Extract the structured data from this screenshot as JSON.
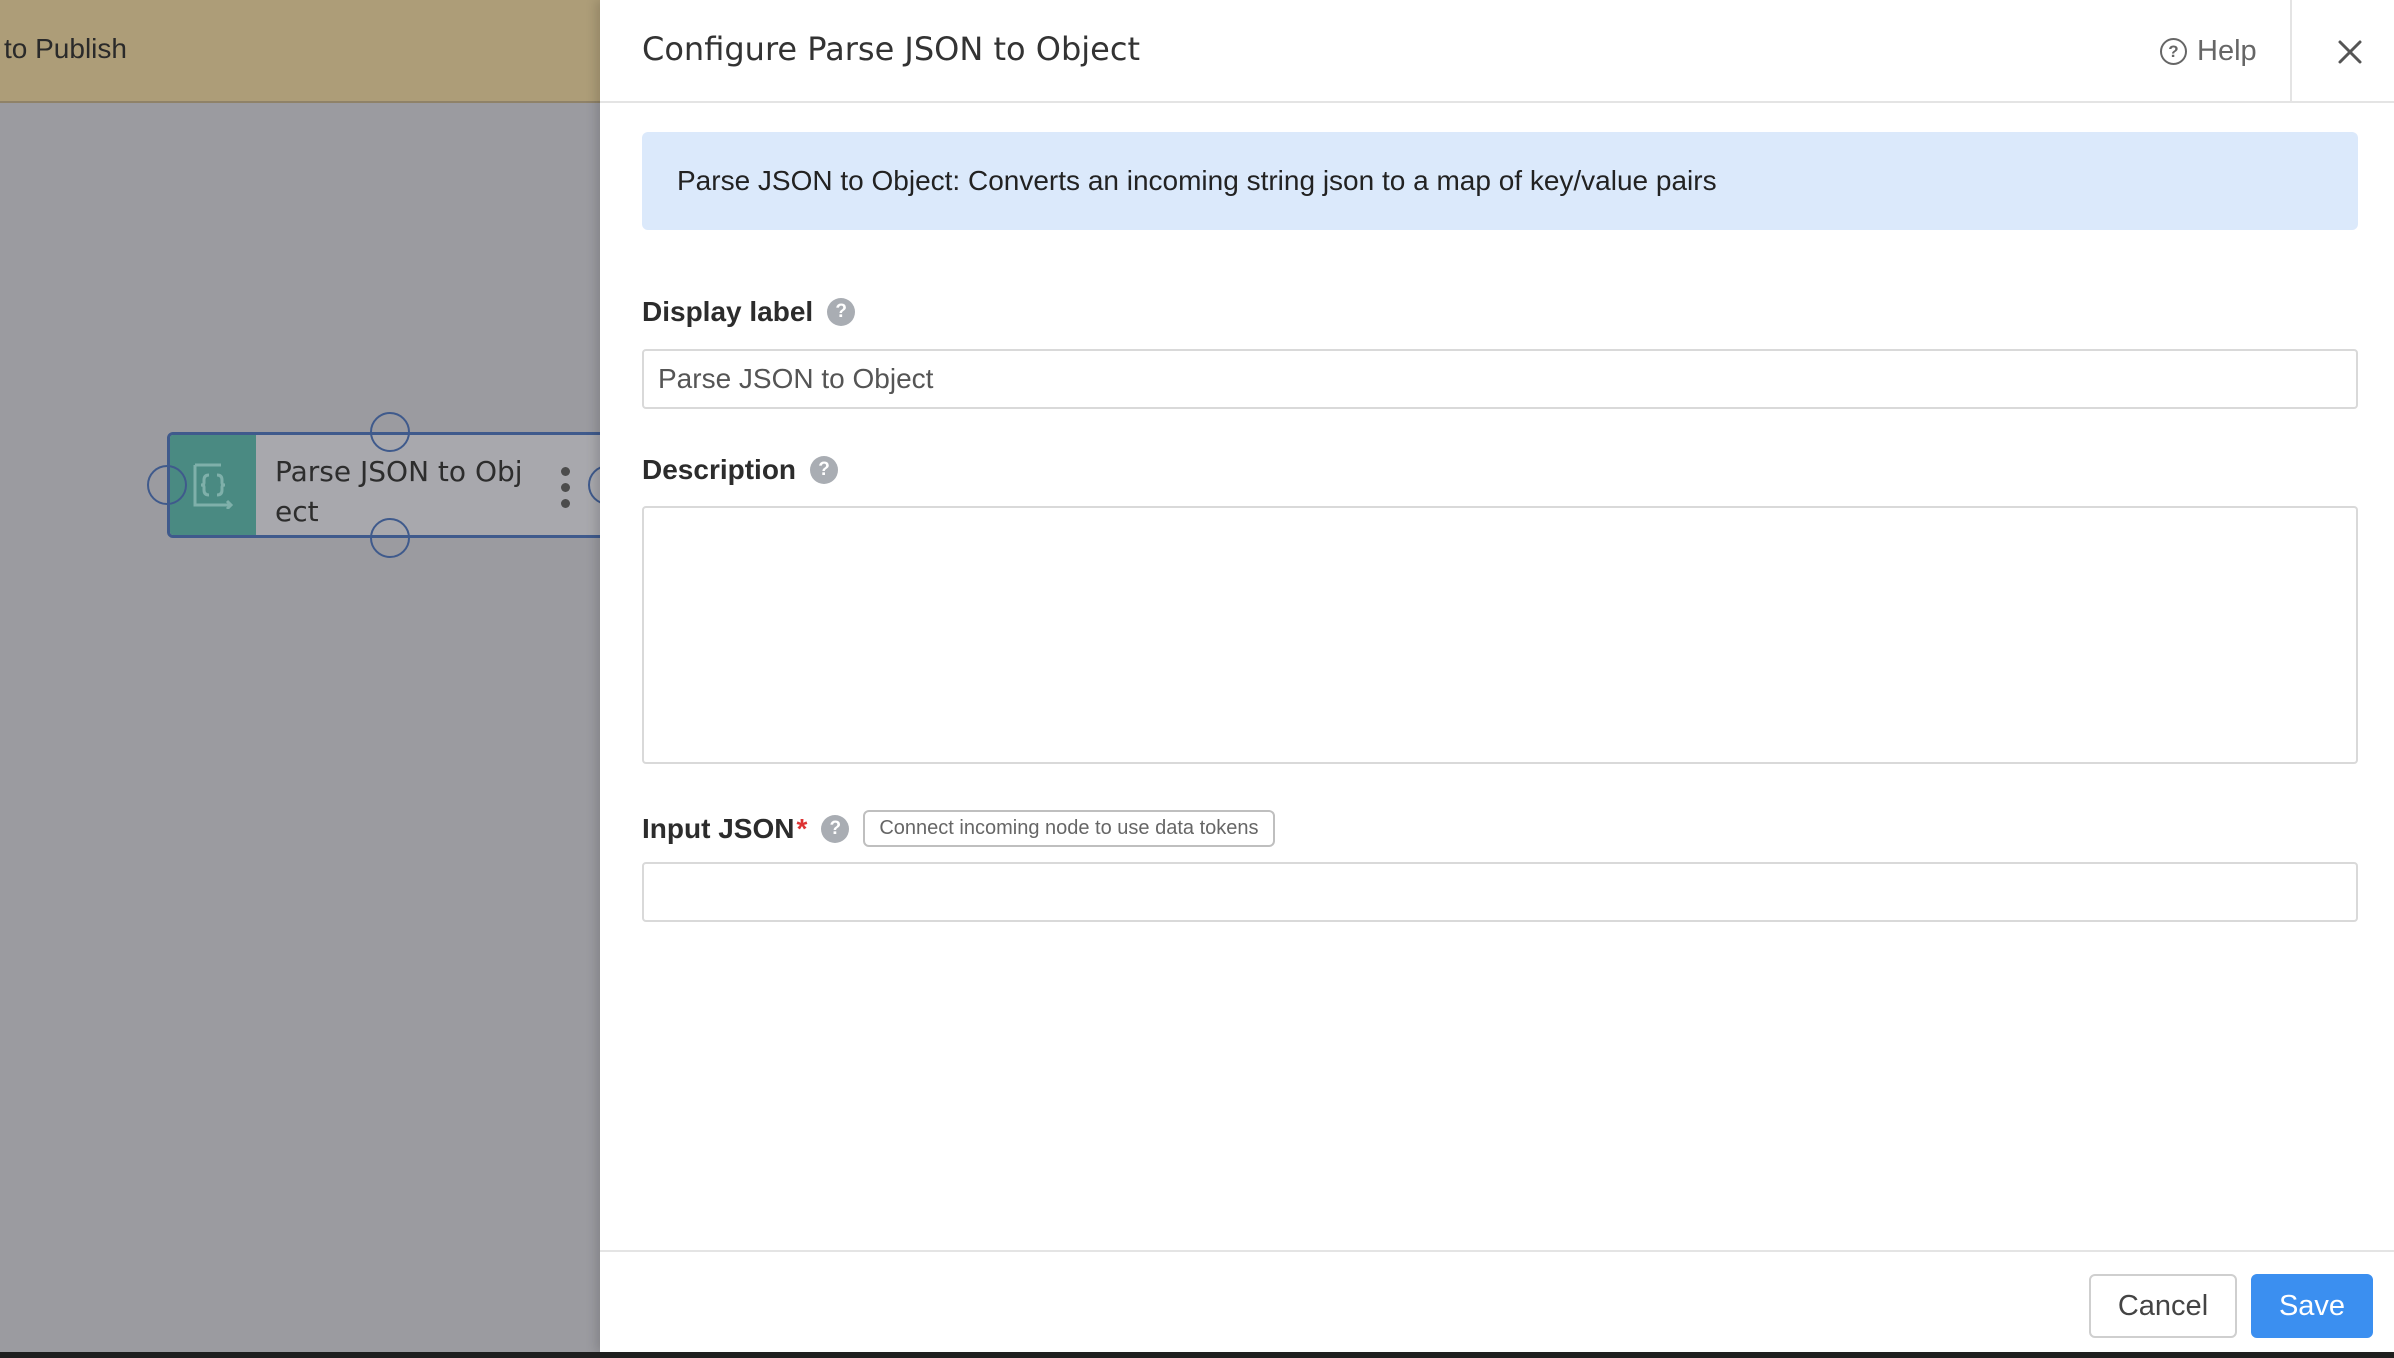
{
  "background": {
    "header_text": "to Publish",
    "node": {
      "label": "Parse JSON to Obj ect",
      "icon": "json-transform-icon",
      "menu_icon": "more-vertical-icon"
    }
  },
  "drawer": {
    "title": "Configure Parse JSON to Object",
    "help_label": "Help",
    "help_icon": "help-circle-icon",
    "close_icon": "close-icon",
    "info_banner": "Parse JSON to Object: Converts an incoming string json to a map of key/value pairs",
    "fields": {
      "display_label": {
        "label": "Display label",
        "value": "Parse JSON to Object"
      },
      "description": {
        "label": "Description",
        "value": ""
      },
      "input_json": {
        "label": "Input JSON",
        "required_mark": "*",
        "hint": "Connect incoming node to use data tokens",
        "value": ""
      }
    },
    "footer": {
      "cancel_label": "Cancel",
      "save_label": "Save"
    }
  },
  "colors": {
    "accent": "#3b8ff0",
    "info_banner_bg": "#dbe9fb",
    "node_icon_bg": "#4a8a82",
    "canvas_header": "#ad9d78"
  }
}
